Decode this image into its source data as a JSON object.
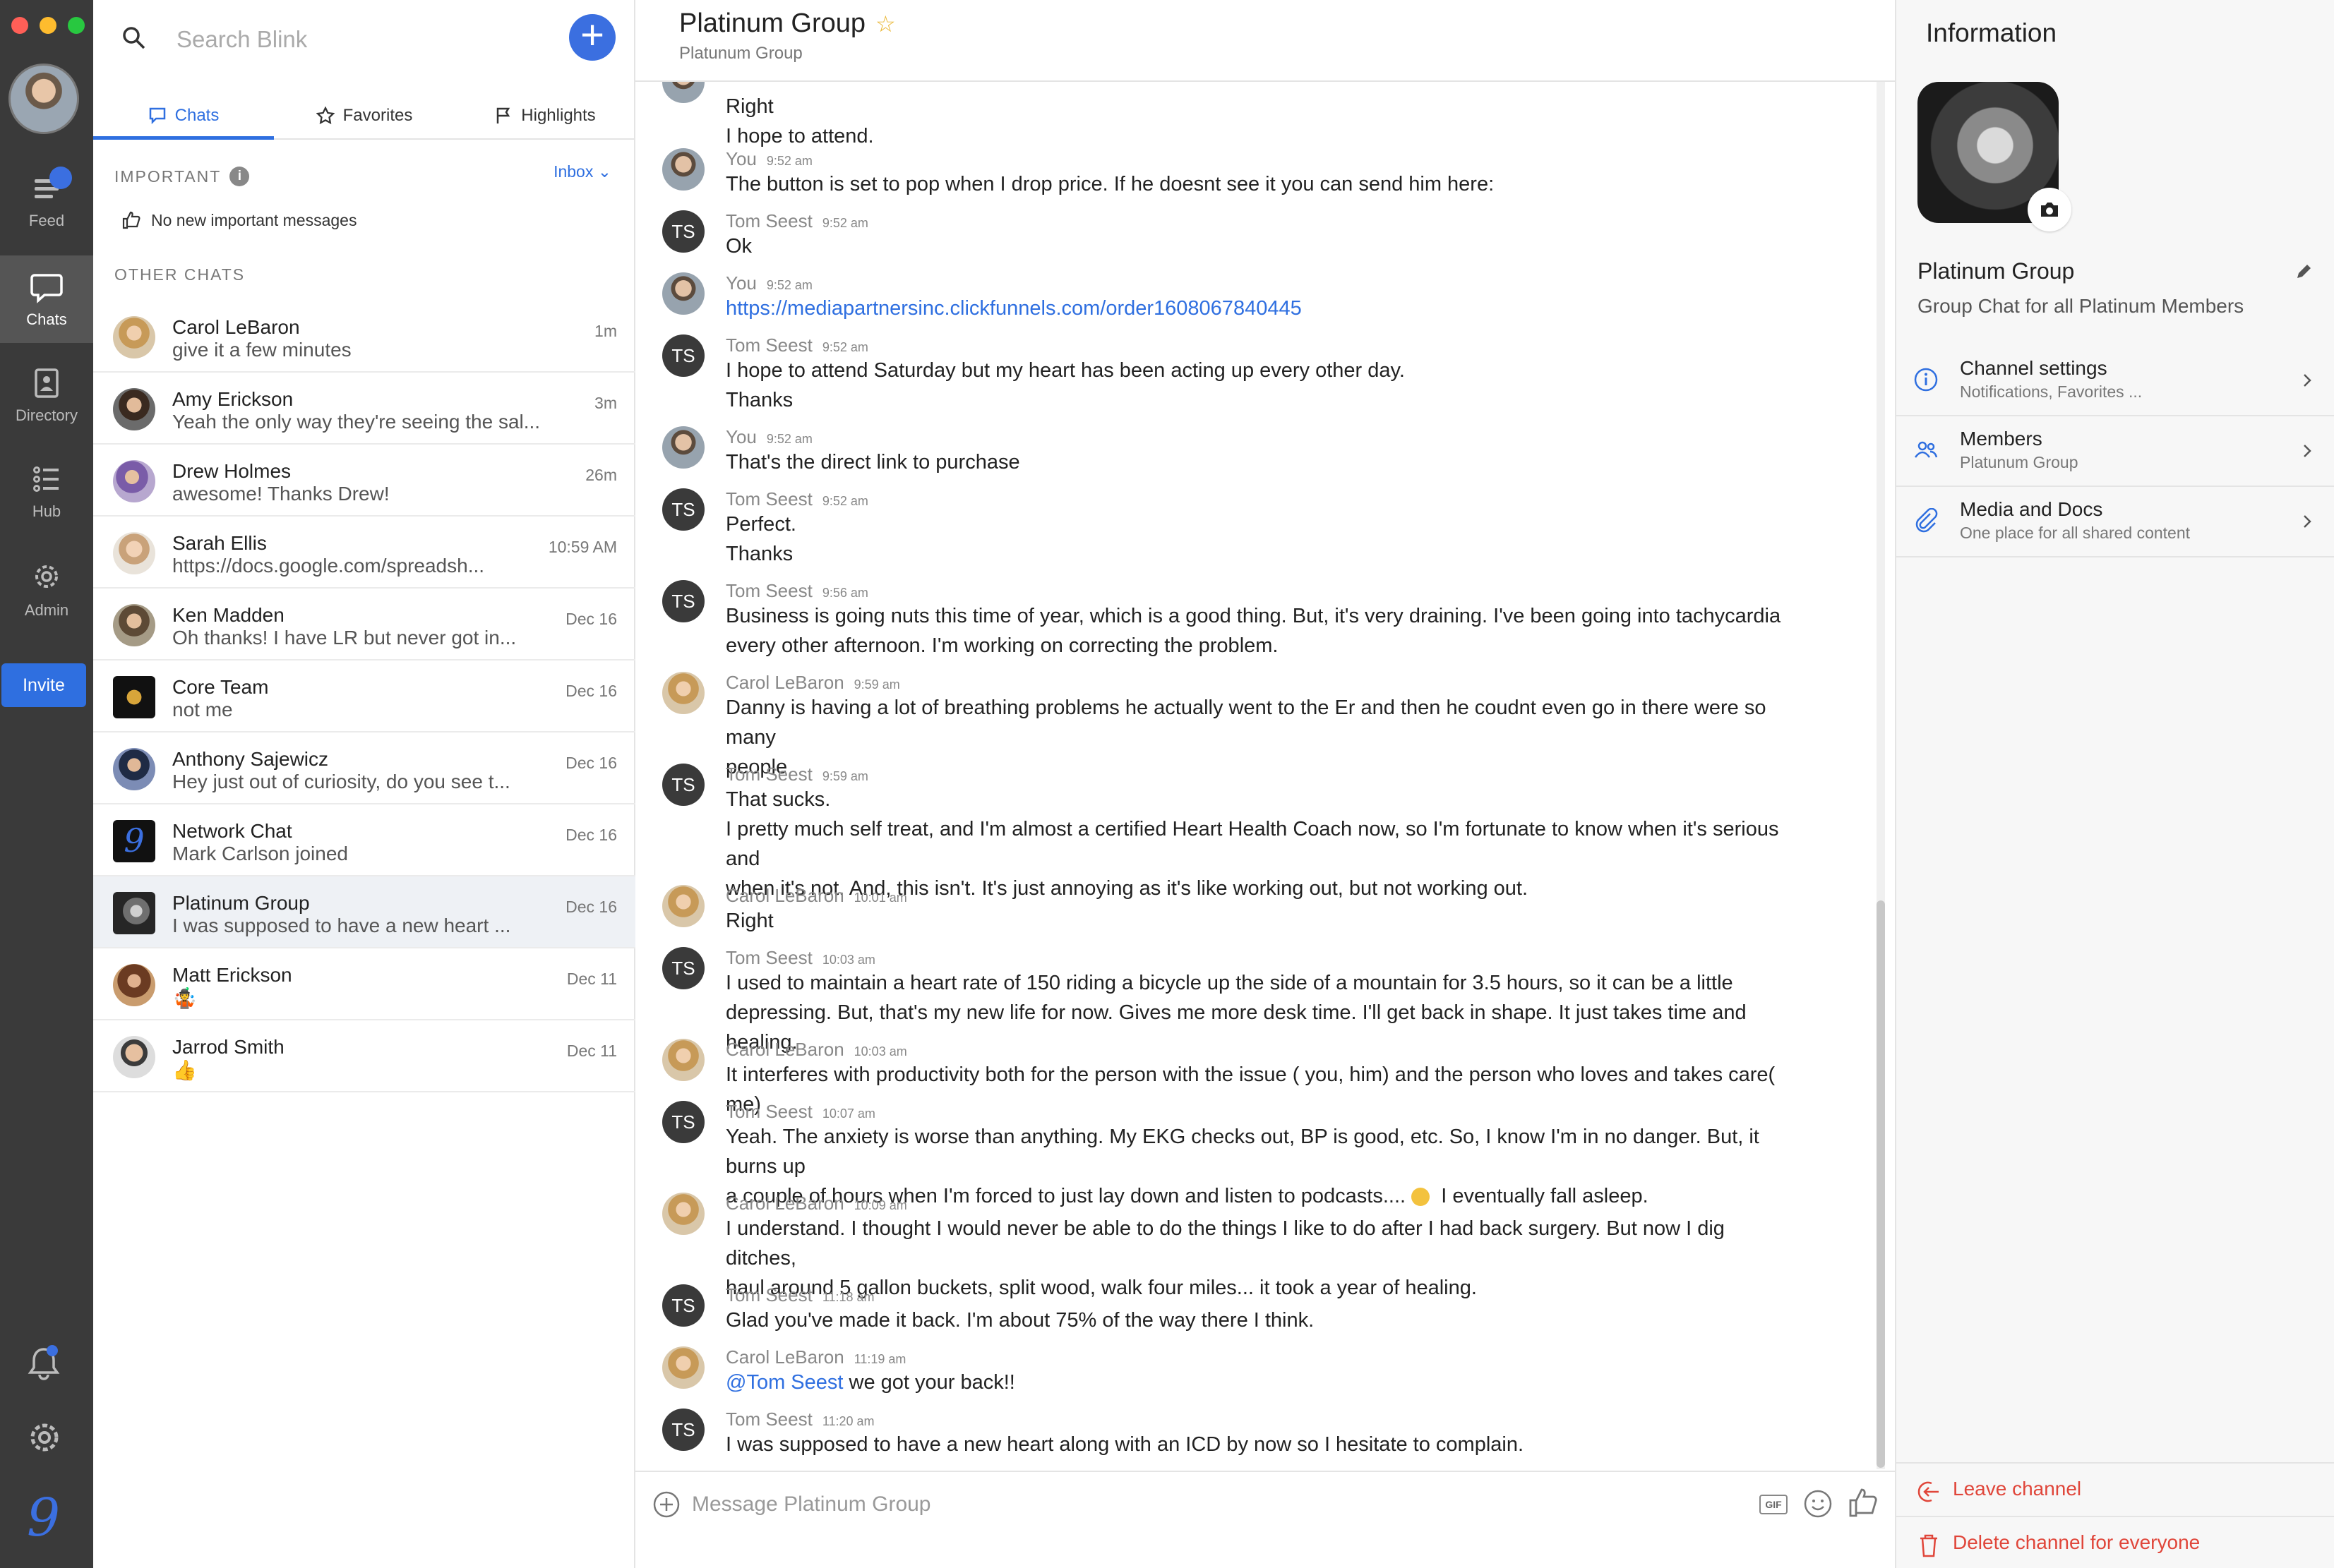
{
  "rail": {
    "items": [
      {
        "label": "Feed"
      },
      {
        "label": "Chats"
      },
      {
        "label": "Directory"
      },
      {
        "label": "Hub"
      },
      {
        "label": "Admin"
      }
    ],
    "invite_label": "Invite",
    "logo_glyph": "9"
  },
  "list": {
    "search_placeholder": "Search Blink",
    "tabs": [
      {
        "label": "Chats"
      },
      {
        "label": "Favorites"
      },
      {
        "label": "Highlights"
      }
    ],
    "important_label": "IMPORTANT",
    "inbox_label": "Inbox",
    "no_important": "No new important messages",
    "other_label": "OTHER CHATS",
    "chats": [
      {
        "name": "Carol LeBaron",
        "preview": "give it a few minutes",
        "time": "1m"
      },
      {
        "name": "Amy Erickson",
        "preview": "Yeah the only way they're seeing the sal...",
        "time": "3m"
      },
      {
        "name": "Drew Holmes",
        "preview": "awesome! Thanks Drew!",
        "time": "26m"
      },
      {
        "name": "Sarah Ellis",
        "preview": "https://docs.google.com/spreadsh...",
        "time": "10:59 AM"
      },
      {
        "name": "Ken Madden",
        "preview": "Oh thanks! I have LR but never got in...",
        "time": "Dec 16"
      },
      {
        "name": "Core Team",
        "preview": "not me",
        "time": "Dec 16"
      },
      {
        "name": "Anthony Sajewicz",
        "preview": "Hey just out of curiosity, do you see t...",
        "time": "Dec 16"
      },
      {
        "name": "Network Chat",
        "preview": "Mark Carlson joined",
        "time": "Dec 16"
      },
      {
        "name": "Platinum Group",
        "preview": "I was supposed to have a new heart ...",
        "time": "Dec 16"
      },
      {
        "name": "Matt Erickson",
        "preview": "🤹",
        "time": "Dec 11"
      },
      {
        "name": "Jarrod Smith",
        "preview": "👍",
        "time": "Dec 11"
      }
    ]
  },
  "conv": {
    "title": "Platinum Group",
    "subtitle": "Platunum Group",
    "composer_placeholder": "Message Platinum Group",
    "gif_label": "GIF",
    "ts_initials": "TS",
    "messages": [
      {
        "author": "",
        "time": "",
        "lines": [
          "Right",
          "I hope to attend."
        ]
      },
      {
        "author": "You",
        "time": "9:52 am",
        "lines": [
          "The button is set to pop when I drop price. If he doesnt see it you can send him here:"
        ]
      },
      {
        "author": "Tom Seest",
        "time": "9:52 am",
        "lines": [
          "Ok"
        ]
      },
      {
        "author": "You",
        "time": "9:52 am",
        "lines": [
          "https://mediapartnersinc.clickfunnels.com/order1608067840445"
        ]
      },
      {
        "author": "Tom Seest",
        "time": "9:52 am",
        "lines": [
          "I hope to attend Saturday but my heart has been acting up every other day.",
          "Thanks"
        ]
      },
      {
        "author": "You",
        "time": "9:52 am",
        "lines": [
          "That's the direct link to purchase"
        ]
      },
      {
        "author": "Tom Seest",
        "time": "9:52 am",
        "lines": [
          "Perfect.",
          "Thanks"
        ]
      },
      {
        "author": "Tom Seest",
        "time": "9:56 am",
        "lines": [
          "Business is going nuts this time of year, which is a good thing. But, it's very draining. I've been going into tachycardia",
          "every other afternoon. I'm working on correcting the problem."
        ]
      },
      {
        "author": "Carol LeBaron",
        "time": "9:59 am",
        "lines": [
          "Danny is having a lot of breathing problems he actually went to the Er and then he coudnt even go in there were so many",
          "people"
        ]
      },
      {
        "author": "Tom Seest",
        "time": "9:59 am",
        "lines": [
          "That sucks.",
          "I pretty much self treat, and I'm almost a certified Heart Health Coach now, so I'm fortunate to know when it's serious and",
          "when it's not. And, this isn't. It's just annoying as it's like working out, but not working out."
        ]
      },
      {
        "author": "Carol LeBaron",
        "time": "10:01 am",
        "lines": [
          "Right"
        ]
      },
      {
        "author": "Tom Seest",
        "time": "10:03 am",
        "lines": [
          "I used to maintain a heart rate of 150 riding a bicycle up the side of a mountain for 3.5 hours, so it can be a little",
          "depressing. But, that's my new life for now. Gives me more desk time. I'll get back in shape. It just takes time and healing."
        ]
      },
      {
        "author": "Carol LeBaron",
        "time": "10:03 am",
        "lines": [
          "It interferes with productivity both for the person with the issue ( you, him) and the person who loves and takes care( me)"
        ]
      },
      {
        "author": "Tom Seest",
        "time": "10:07 am",
        "lines": [
          "Yeah. The anxiety is worse than anything. My EKG checks out, BP is good, etc. So, I know I'm in no danger. But, it burns up",
          "a couple of hours when I'm forced to just lay down and listen to podcasts....",
          "I eventually fall asleep."
        ]
      },
      {
        "author": "Carol LeBaron",
        "time": "10:09 am",
        "lines": [
          "I understand. I thought I would never be able to do the things I like to do after I had back surgery. But now I dig ditches,",
          "haul around 5 gallon buckets, split wood, walk four miles... it took a year of healing."
        ]
      },
      {
        "author": "Tom Seest",
        "time": "11:18 am",
        "lines": [
          "Glad you've made it back. I'm about 75% of the way there I think."
        ]
      },
      {
        "author": "Carol LeBaron",
        "time": "11:19 am",
        "lines": [
          "@Tom Seest",
          " we got your back!!"
        ]
      },
      {
        "author": "Tom Seest",
        "time": "11:20 am",
        "lines": [
          "I was supposed to have a new heart along with an ICD by now so I hesitate to complain."
        ]
      }
    ]
  },
  "info": {
    "title": "Information",
    "group_name": "Platinum Group",
    "group_desc": "Group Chat for all Platinum Members",
    "rows": [
      {
        "title": "Channel settings",
        "sub": "Notifications, Favorites ..."
      },
      {
        "title": "Members",
        "sub": "Platunum Group"
      },
      {
        "title": "Media and Docs",
        "sub": "One place for all shared content"
      }
    ],
    "leave_label": "Leave channel",
    "delete_label": "Delete channel for everyone"
  },
  "colors": {
    "accent": "#2f6fe0",
    "danger": "#e0463a",
    "rail": "#3a3a3a"
  },
  "icons": [
    "search-icon",
    "plus-icon",
    "chat-icon",
    "star-icon",
    "flag-icon",
    "feed-icon",
    "directory-icon",
    "hub-icon",
    "admin-icon",
    "bell-icon",
    "gear-icon",
    "camera-icon",
    "pencil-icon",
    "info-icon",
    "members-icon",
    "paperclip-icon",
    "leave-icon",
    "trash-icon",
    "gif-icon",
    "emoji-icon",
    "thumbs-up-icon"
  ]
}
